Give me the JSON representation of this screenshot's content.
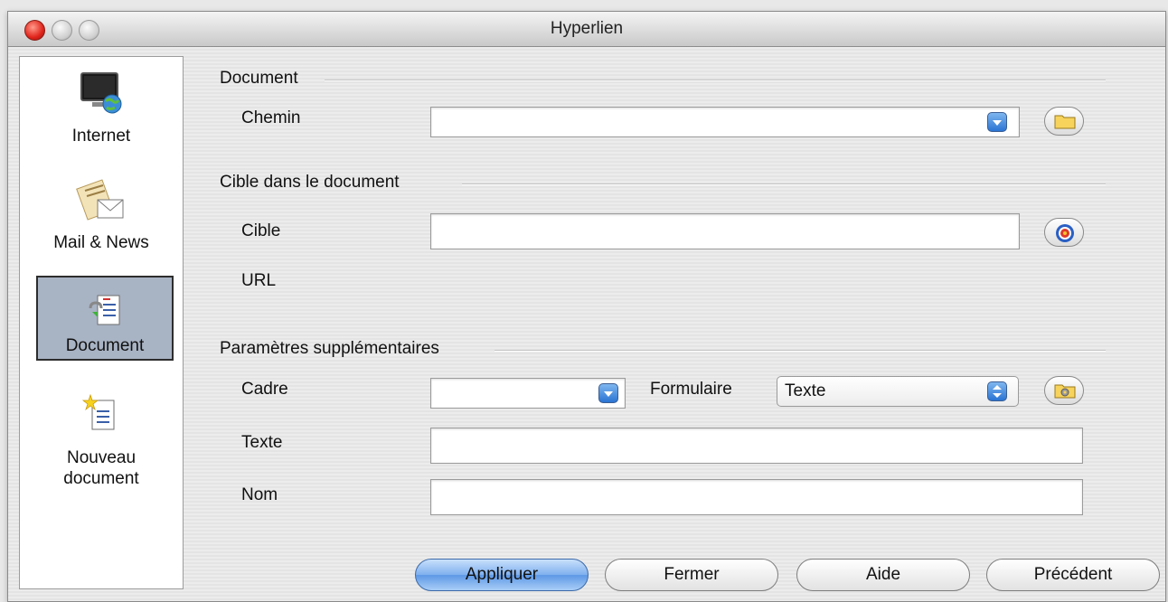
{
  "window": {
    "title": "Hyperlien"
  },
  "sidebar": {
    "items": [
      {
        "label": "Internet",
        "icon": "internet-icon",
        "selected": false
      },
      {
        "label": "Mail & News",
        "icon": "mail-news-icon",
        "selected": false
      },
      {
        "label": "Document",
        "icon": "document-icon",
        "selected": true
      },
      {
        "label_line1": "Nouveau",
        "label_line2": "document",
        "icon": "new-document-icon",
        "selected": false
      }
    ]
  },
  "sections": {
    "document": {
      "title": "Document",
      "path_label": "Chemin",
      "path_value": ""
    },
    "target": {
      "title": "Cible dans le document",
      "target_label": "Cible",
      "target_value": "",
      "url_label": "URL",
      "url_value": ""
    },
    "extra": {
      "title": "Paramètres supplémentaires",
      "frame_label": "Cadre",
      "frame_value": "",
      "form_label": "Formulaire",
      "form_value": "Texte",
      "text_label": "Texte",
      "text_value": "",
      "name_label": "Nom",
      "name_value": ""
    }
  },
  "buttons": {
    "apply": "Appliquer",
    "close": "Fermer",
    "help": "Aide",
    "previous": "Précédent"
  }
}
